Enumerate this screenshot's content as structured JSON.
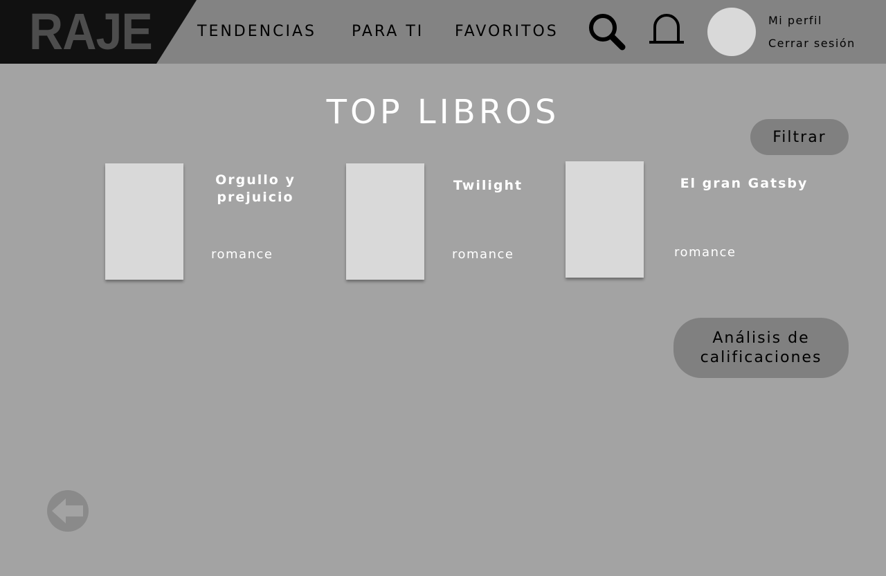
{
  "brand": {
    "logo_text": "RAJE"
  },
  "nav": {
    "trending": "TENDENCIAS",
    "for_you": "PARA TI",
    "favorites": "FAVORITOS"
  },
  "user": {
    "profile": "Mi perfil",
    "logout": "Cerrar sesión"
  },
  "page": {
    "title": "TOP LIBROS",
    "filter_label": "Filtrar",
    "analysis_label": "Análisis de calificaciones"
  },
  "books": [
    {
      "title": "Orgullo y prejuicio",
      "genre": "romance"
    },
    {
      "title": "Twilight",
      "genre": "romance"
    },
    {
      "title": "El gran Gatsby",
      "genre": "romance"
    }
  ],
  "icons": {
    "search": "search-icon",
    "notifications": "bell-icon",
    "back": "arrow-left-icon"
  },
  "colors": {
    "background": "#a3a3a3",
    "topbar": "#838383",
    "logo_block": "#111111",
    "logo_text": "#4d4d4d",
    "button": "#808080",
    "cover": "#d9d9d9"
  }
}
